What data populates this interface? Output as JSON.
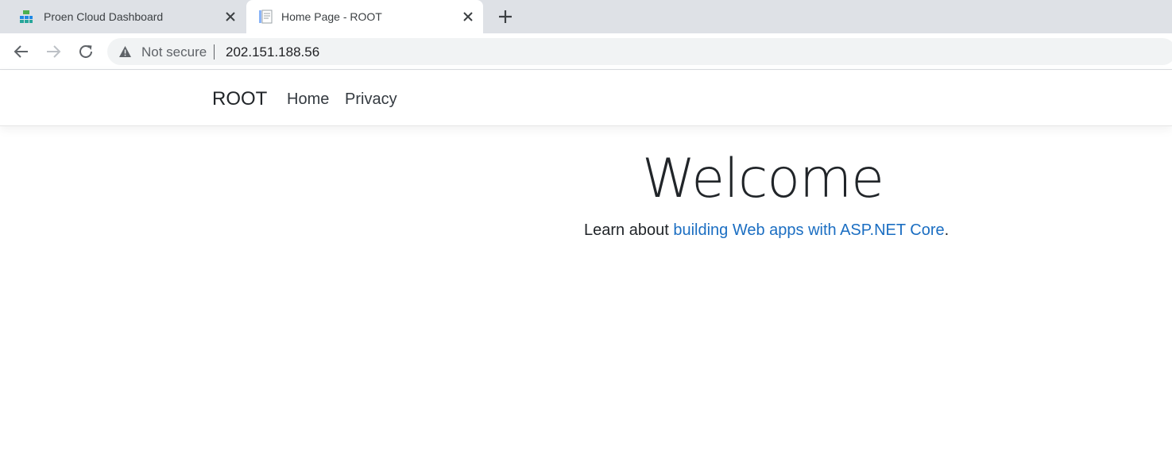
{
  "tabs": [
    {
      "title": "Proen Cloud Dashboard",
      "active": false,
      "icon": "cloud-dashboard-icon"
    },
    {
      "title": "Home Page - ROOT",
      "active": true,
      "icon": "document-icon"
    }
  ],
  "toolbar": {
    "security_label": "Not secure",
    "url": "202.151.188.56"
  },
  "page": {
    "brand": "ROOT",
    "nav": [
      "Home",
      "Privacy"
    ],
    "heading": "Welcome",
    "learn_prefix": "Learn about ",
    "learn_link": "building Web apps with ASP.NET Core",
    "learn_suffix": "."
  },
  "colors": {
    "link": "#1b6ec2",
    "tabstrip": "#dee1e6",
    "omnibox": "#f1f3f4"
  }
}
